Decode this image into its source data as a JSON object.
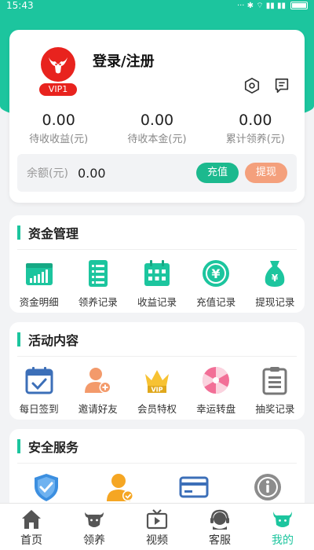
{
  "status_bar": {
    "time": "15:43",
    "icons": "··· ✱ ⌔ ▮▮ ▮▮"
  },
  "profile": {
    "login_label": "登录/注册",
    "vip_label": "VIP1"
  },
  "stats": [
    {
      "value": "0.00",
      "label": "待收收益(元)"
    },
    {
      "value": "0.00",
      "label": "待收本金(元)"
    },
    {
      "value": "0.00",
      "label": "累计领养(元)"
    }
  ],
  "balance": {
    "label": "余额(元)",
    "value": "0.00",
    "recharge_label": "充值",
    "withdraw_label": "提现"
  },
  "sections": {
    "funds": {
      "title": "资金管理",
      "items": [
        {
          "label": "资金明细",
          "icon": "chart-icon"
        },
        {
          "label": "领养记录",
          "icon": "list-icon"
        },
        {
          "label": "收益记录",
          "icon": "calendar-icon"
        },
        {
          "label": "充值记录",
          "icon": "yen-coin-icon"
        },
        {
          "label": "提现记录",
          "icon": "money-bag-icon"
        }
      ]
    },
    "activity": {
      "title": "活动内容",
      "items": [
        {
          "label": "每日签到",
          "icon": "checkin-calendar-icon"
        },
        {
          "label": "邀请好友",
          "icon": "invite-user-icon"
        },
        {
          "label": "会员特权",
          "icon": "vip-crown-icon"
        },
        {
          "label": "幸运转盘",
          "icon": "wheel-icon"
        },
        {
          "label": "抽奖记录",
          "icon": "clipboard-icon"
        }
      ]
    },
    "security": {
      "title": "安全服务",
      "items": [
        {
          "icon": "shield-check-icon"
        },
        {
          "icon": "verified-user-icon"
        },
        {
          "icon": "bank-card-icon"
        },
        {
          "icon": "info-icon"
        }
      ]
    }
  },
  "tabbar": [
    {
      "label": "首页",
      "icon": "home-icon"
    },
    {
      "label": "领养",
      "icon": "cow-icon"
    },
    {
      "label": "视频",
      "icon": "video-icon"
    },
    {
      "label": "客服",
      "icon": "headset-icon"
    },
    {
      "label": "我的",
      "icon": "profile-cow-icon",
      "active": true
    }
  ],
  "colors": {
    "accent": "#1cc59e",
    "vip": "#e8231e",
    "withdraw": "#f4a07c"
  }
}
